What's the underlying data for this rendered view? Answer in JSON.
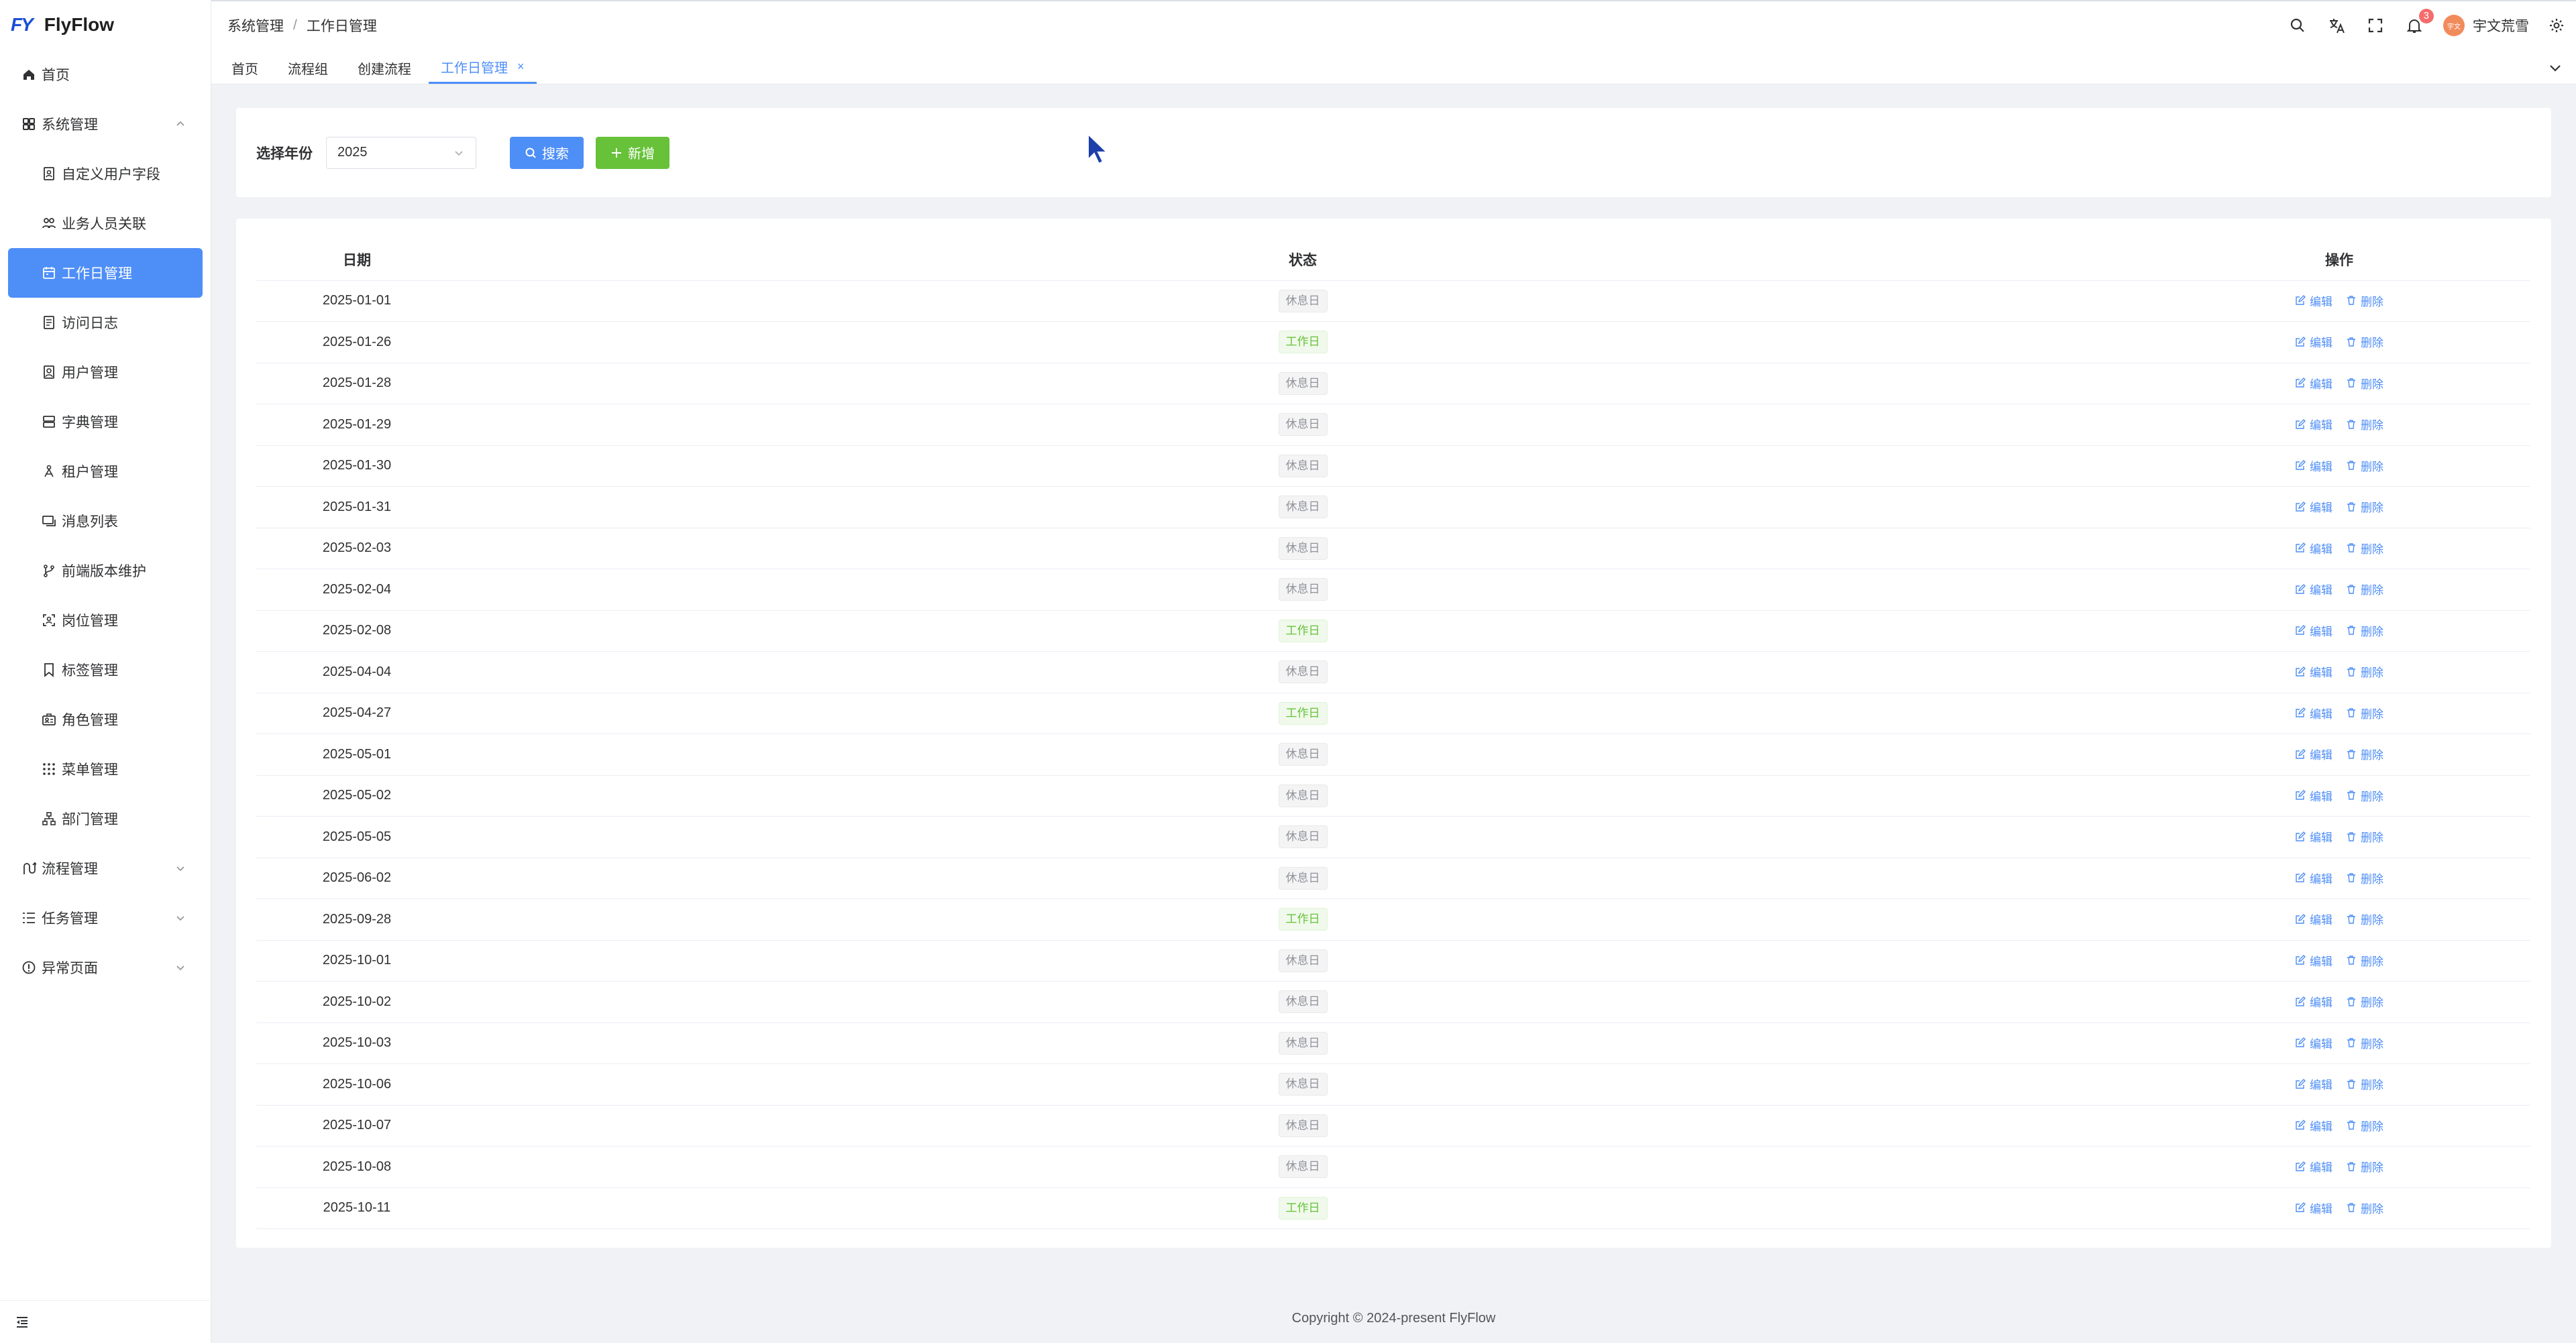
{
  "app": {
    "logo_mark": "FY",
    "name": "FlyFlow"
  },
  "sidebar": {
    "items": [
      {
        "label": "首页",
        "icon": "home-icon",
        "level": "top"
      },
      {
        "label": "系统管理",
        "icon": "apps-icon",
        "level": "top",
        "expanded": true
      },
      {
        "label": "自定义用户字段",
        "icon": "user-field-icon",
        "level": "sub"
      },
      {
        "label": "业务人员关联",
        "icon": "users-icon",
        "level": "sub"
      },
      {
        "label": "工作日管理",
        "icon": "calendar-icon",
        "level": "sub",
        "active": true
      },
      {
        "label": "访问日志",
        "icon": "log-icon",
        "level": "sub"
      },
      {
        "label": "用户管理",
        "icon": "user-icon",
        "level": "sub"
      },
      {
        "label": "字典管理",
        "icon": "dictionary-icon",
        "level": "sub"
      },
      {
        "label": "租户管理",
        "icon": "tenant-icon",
        "level": "sub"
      },
      {
        "label": "消息列表",
        "icon": "message-icon",
        "level": "sub"
      },
      {
        "label": "前端版本维护",
        "icon": "branch-icon",
        "level": "sub"
      },
      {
        "label": "岗位管理",
        "icon": "position-icon",
        "level": "sub"
      },
      {
        "label": "标签管理",
        "icon": "tag-icon",
        "level": "sub"
      },
      {
        "label": "角色管理",
        "icon": "role-icon",
        "level": "sub"
      },
      {
        "label": "菜单管理",
        "icon": "menu-grid-icon",
        "level": "sub"
      },
      {
        "label": "部门管理",
        "icon": "org-icon",
        "level": "sub"
      },
      {
        "label": "流程管理",
        "icon": "flow-icon",
        "level": "top",
        "expanded": false
      },
      {
        "label": "任务管理",
        "icon": "task-icon",
        "level": "top",
        "expanded": false
      },
      {
        "label": "异常页面",
        "icon": "warning-icon",
        "level": "top",
        "expanded": false
      }
    ]
  },
  "header": {
    "breadcrumb": [
      "系统管理",
      "工作日管理"
    ],
    "notification_count": "3",
    "username": "宇文荒雪",
    "avatar_text": "宇文"
  },
  "tabs": [
    {
      "label": "首页",
      "active": false
    },
    {
      "label": "流程组",
      "active": false
    },
    {
      "label": "创建流程",
      "active": false
    },
    {
      "label": "工作日管理",
      "active": true,
      "close": "×"
    }
  ],
  "filter": {
    "label": "选择年份",
    "year_value": "2025",
    "search_label": "搜索",
    "add_label": "新增"
  },
  "table": {
    "headers": {
      "date": "日期",
      "status": "状态",
      "actions": "操作"
    },
    "edit_label": "编辑",
    "delete_label": "删除",
    "rows": [
      {
        "date": "2025-01-01",
        "status": "休息日",
        "type": "rest"
      },
      {
        "date": "2025-01-26",
        "status": "工作日",
        "type": "work"
      },
      {
        "date": "2025-01-28",
        "status": "休息日",
        "type": "rest"
      },
      {
        "date": "2025-01-29",
        "status": "休息日",
        "type": "rest"
      },
      {
        "date": "2025-01-30",
        "status": "休息日",
        "type": "rest"
      },
      {
        "date": "2025-01-31",
        "status": "休息日",
        "type": "rest"
      },
      {
        "date": "2025-02-03",
        "status": "休息日",
        "type": "rest"
      },
      {
        "date": "2025-02-04",
        "status": "休息日",
        "type": "rest"
      },
      {
        "date": "2025-02-08",
        "status": "工作日",
        "type": "work"
      },
      {
        "date": "2025-04-04",
        "status": "休息日",
        "type": "rest"
      },
      {
        "date": "2025-04-27",
        "status": "工作日",
        "type": "work"
      },
      {
        "date": "2025-05-01",
        "status": "休息日",
        "type": "rest"
      },
      {
        "date": "2025-05-02",
        "status": "休息日",
        "type": "rest"
      },
      {
        "date": "2025-05-05",
        "status": "休息日",
        "type": "rest"
      },
      {
        "date": "2025-06-02",
        "status": "休息日",
        "type": "rest"
      },
      {
        "date": "2025-09-28",
        "status": "工作日",
        "type": "work"
      },
      {
        "date": "2025-10-01",
        "status": "休息日",
        "type": "rest"
      },
      {
        "date": "2025-10-02",
        "status": "休息日",
        "type": "rest"
      },
      {
        "date": "2025-10-03",
        "status": "休息日",
        "type": "rest"
      },
      {
        "date": "2025-10-06",
        "status": "休息日",
        "type": "rest"
      },
      {
        "date": "2025-10-07",
        "status": "休息日",
        "type": "rest"
      },
      {
        "date": "2025-10-08",
        "status": "休息日",
        "type": "rest"
      },
      {
        "date": "2025-10-11",
        "status": "工作日",
        "type": "work"
      }
    ]
  },
  "footer": {
    "text": "Copyright © 2024-present FlyFlow"
  },
  "colors": {
    "primary": "#4e8ef7",
    "success": "#67c23a",
    "rest_tag": "#909399",
    "badge": "#f56c6c"
  }
}
